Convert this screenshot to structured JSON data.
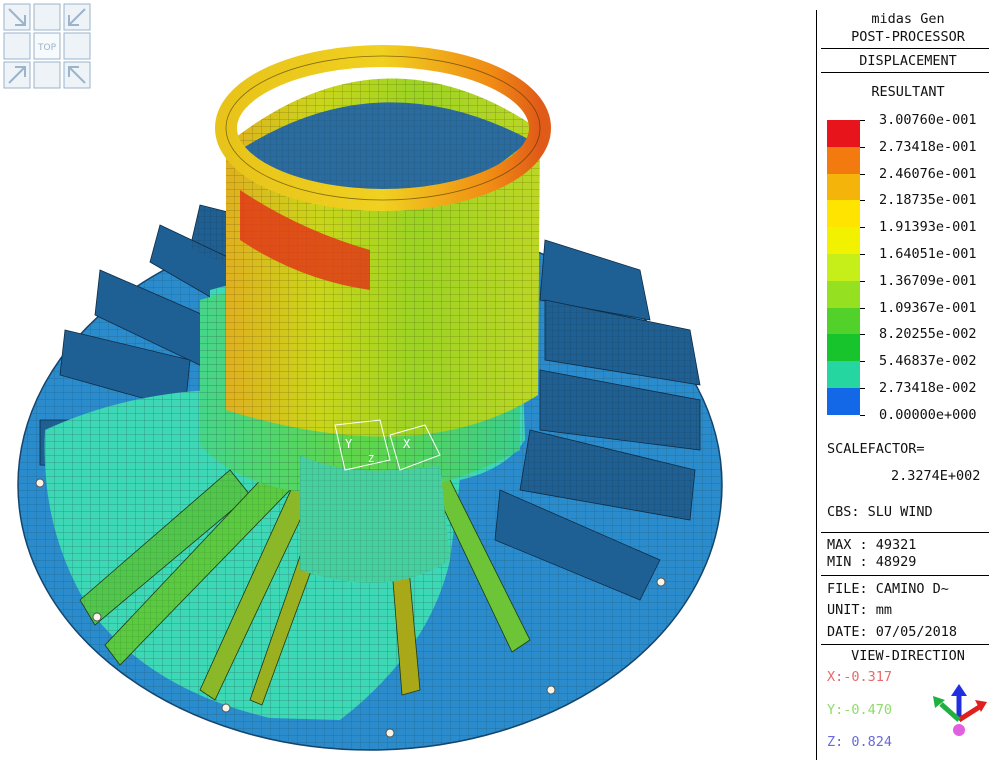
{
  "app": {
    "title": "midas Gen",
    "subtitle": "POST-PROCESSOR"
  },
  "result": {
    "type": "DISPLACEMENT",
    "component": "RESULTANT"
  },
  "legend": {
    "values": [
      "3.00760e-001",
      "2.73418e-001",
      "2.46076e-001",
      "2.18735e-001",
      "1.91393e-001",
      "1.64051e-001",
      "1.36709e-001",
      "1.09367e-001",
      "8.20255e-002",
      "5.46837e-002",
      "2.73418e-002",
      "0.00000e+000"
    ],
    "colors": [
      "#e8141c",
      "#f37a0e",
      "#f4b40a",
      "#ffe400",
      "#f2f200",
      "#c6ef1a",
      "#94e021",
      "#52d12a",
      "#18c42c",
      "#25d6a0",
      "#26f0f0",
      "#1368e8"
    ]
  },
  "scale": {
    "label": "SCALEFACTOR=",
    "value": "2.3274E+002"
  },
  "load_case": "CBS: SLU WIND",
  "extremes": {
    "max": "MAX : 49321",
    "min": "MIN : 48929"
  },
  "file_info": {
    "file": "FILE: CAMINO D~",
    "unit": "UNIT: mm",
    "date": "DATE: 07/05/2018"
  },
  "view_direction": {
    "title": "VIEW-DIRECTION",
    "x": "X:-0.317",
    "y": "Y:-0.470",
    "z": "Z: 0.824"
  },
  "view_cube": {
    "face_label": "TOP"
  },
  "model_axes": {
    "x_label": "X",
    "y_label": "Y",
    "z_label": "Z"
  },
  "colors": {
    "base_plate": "#2a8ccc",
    "stiffener": "#1e5f94",
    "mesh_line": "#1b2a2a"
  }
}
